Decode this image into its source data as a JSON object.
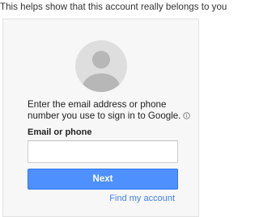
{
  "header": {
    "message": "This helps show that this account really belongs to you"
  },
  "card": {
    "avatar_icon": "default-user-avatar-icon",
    "prompt": "Enter the email address or phone number you use to sign in to Google.",
    "info_icon": "info-circle-icon",
    "field_label": "Email or phone",
    "field_value": "",
    "field_placeholder": "",
    "next_label": "Next",
    "find_account_label": "Find my account"
  },
  "colors": {
    "primary_button": "#4d90fe",
    "link": "#427fed",
    "card_background": "#f7f7f7",
    "avatar_background": "#dedede",
    "avatar_figure": "#b7b7b7"
  }
}
